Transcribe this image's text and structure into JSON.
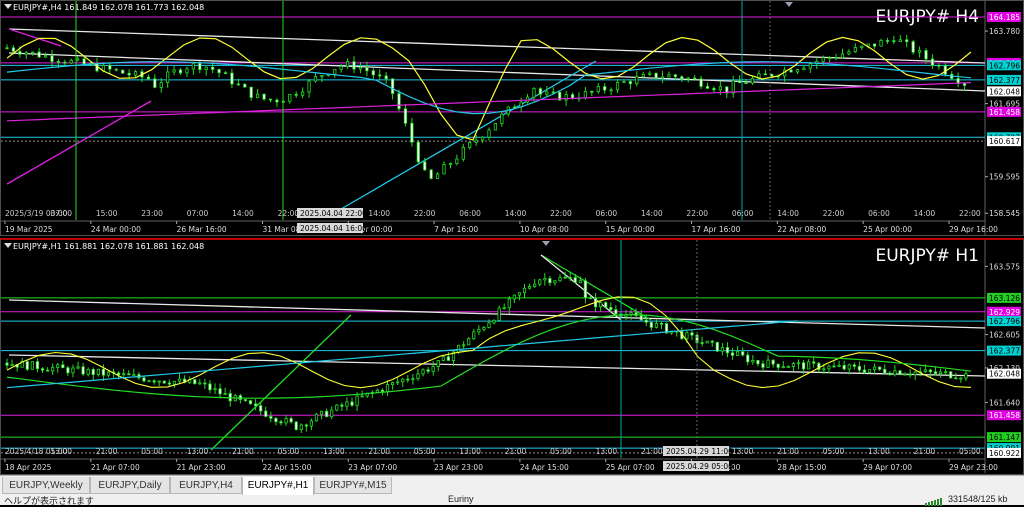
{
  "charts": [
    {
      "id": "h4",
      "symbol_header": "EURJPY#,H4  161.849 162.078 161.773 162.048",
      "watermark": "EURJPY# H4",
      "price_labels": [
        {
          "text": "164.185",
          "price": 164.185,
          "bg": "#e000e0",
          "fg": "#ffffff"
        },
        {
          "text": "163.780",
          "price": 163.78,
          "bg": null,
          "fg": "#dddddd"
        },
        {
          "text": "162.866",
          "price": 162.866,
          "bg": "#e000e0",
          "fg": "#ffffff"
        },
        {
          "text": "162.796",
          "price": 162.796,
          "bg": "#00d0d0",
          "fg": "#000000"
        },
        {
          "text": "162.377",
          "price": 162.377,
          "bg": "#00d0d0",
          "fg": "#000000"
        },
        {
          "text": "162.048",
          "price": 162.048,
          "bg": "#ffffff",
          "fg": "#000000"
        },
        {
          "text": "161.695",
          "price": 161.695,
          "bg": null,
          "fg": "#dddddd"
        },
        {
          "text": "161.458",
          "price": 161.458,
          "bg": "#e000e0",
          "fg": "#ffffff"
        },
        {
          "text": "160.727",
          "price": 160.727,
          "bg": "#00d0d0",
          "fg": "#000000"
        },
        {
          "text": "160.617",
          "price": 160.617,
          "bg": "#ffffff",
          "fg": "#000000"
        },
        {
          "text": "159.595",
          "price": 159.595,
          "bg": null,
          "fg": "#dddddd"
        },
        {
          "text": "158.545",
          "price": 158.545,
          "bg": null,
          "fg": "#dddddd"
        }
      ],
      "upper_time_labels": [
        "2025/3/19 03:00",
        "07:00",
        "15:00",
        "23:00",
        "07:00",
        "14:00",
        "22:00",
        "06:00",
        "14:00",
        "22:00",
        "06:00",
        "14:00",
        "22:00",
        "06:00",
        "14:00",
        "22:00",
        "06:00",
        "14:00",
        "22:00",
        "06:00",
        "14:00",
        "22:00"
      ],
      "lower_time_labels": [
        "19 Mar 2025",
        "24 Mar 00:00",
        "26 Mar 16:00",
        "31 Mar 08:00",
        "3 Apr 00:00",
        "7 Apr 16:00",
        "10 Apr 08:00",
        "15 Apr 00:00",
        "17 Apr 16:00",
        "22 Apr 08:00",
        "25 Apr 00:00",
        "29 Apr 16:00"
      ],
      "crosshair_labels": [
        "2025.04.04 22:00",
        "2025.04.04 16:00"
      ],
      "colors": {
        "yellow": "#ffff33",
        "green": "#22dd22",
        "cyan": "#22c8e8",
        "magenta": "#e020e0",
        "white": "#e8e8e8"
      }
    },
    {
      "id": "h1",
      "symbol_header": "EURJPY#,H1  161.881 162.078 161.881 162.048",
      "watermark": "EURJPY# H1",
      "price_labels": [
        {
          "text": "163.575",
          "price": 163.575,
          "bg": null,
          "fg": "#dddddd"
        },
        {
          "text": "163.126",
          "price": 163.126,
          "bg": "#22cc22",
          "fg": "#000000"
        },
        {
          "text": "162.929",
          "price": 162.929,
          "bg": "#e000e0",
          "fg": "#ffffff"
        },
        {
          "text": "162.796",
          "price": 162.796,
          "bg": "#00d0d0",
          "fg": "#000000"
        },
        {
          "text": "162.605",
          "price": 162.605,
          "bg": null,
          "fg": "#dddddd"
        },
        {
          "text": "162.377",
          "price": 162.377,
          "bg": "#00d0d0",
          "fg": "#000000"
        },
        {
          "text": "162.130",
          "price": 162.13,
          "bg": null,
          "fg": "#dddddd"
        },
        {
          "text": "162.048",
          "price": 162.048,
          "bg": "#ffffff",
          "fg": "#000000"
        },
        {
          "text": "161.640",
          "price": 161.64,
          "bg": null,
          "fg": "#dddddd"
        },
        {
          "text": "161.458",
          "price": 161.458,
          "bg": "#e000e0",
          "fg": "#ffffff"
        },
        {
          "text": "161.147",
          "price": 161.147,
          "bg": "#22cc22",
          "fg": "#000000"
        },
        {
          "text": "160.991",
          "price": 160.991,
          "bg": "#00d0d0",
          "fg": "#000000"
        },
        {
          "text": "160.922",
          "price": 160.922,
          "bg": "#ffffff",
          "fg": "#000000"
        }
      ],
      "upper_time_labels": [
        "2025/4/18 05:00",
        "13:00",
        "21:00",
        "05:00",
        "13:00",
        "21:00",
        "05:00",
        "13:00",
        "21:00",
        "05:00",
        "13:00",
        "21:00",
        "05:00",
        "13:00",
        "21:00",
        "05:00",
        "13:00",
        "21:00",
        "05:00",
        "13:00",
        "21:00",
        "05:00"
      ],
      "lower_time_labels": [
        "18 Apr 2025",
        "21 Apr 07:00",
        "21 Apr 23:00",
        "22 Apr 15:00",
        "23 Apr 07:00",
        "23 Apr 23:00",
        "24 Apr 15:00",
        "25 Apr 07:00",
        "25 Apr 23:00",
        "28 Apr 15:00",
        "29 Apr 07:00",
        "29 Apr 23:00"
      ],
      "crosshair_labels": [
        "2025.04.29 11:00",
        "2025.04.29 05:00"
      ],
      "colors": {
        "yellow": "#ffff33",
        "green": "#22dd22",
        "cyan": "#22c8e8",
        "magenta": "#e020e0",
        "white": "#e8e8e8"
      }
    }
  ],
  "tabs": [
    {
      "label": "EURJPY,Weekly",
      "active": false
    },
    {
      "label": "EURJPY,Daily",
      "active": false
    },
    {
      "label": "EURJPY,H4",
      "active": false
    },
    {
      "label": "EURJPY#,H1",
      "active": true
    },
    {
      "label": "EURJPY#,M15",
      "active": false
    }
  ],
  "status": {
    "help_text": "ヘルプが表示されます",
    "profile": "Euriny",
    "traffic": "331548/125 kb"
  }
}
